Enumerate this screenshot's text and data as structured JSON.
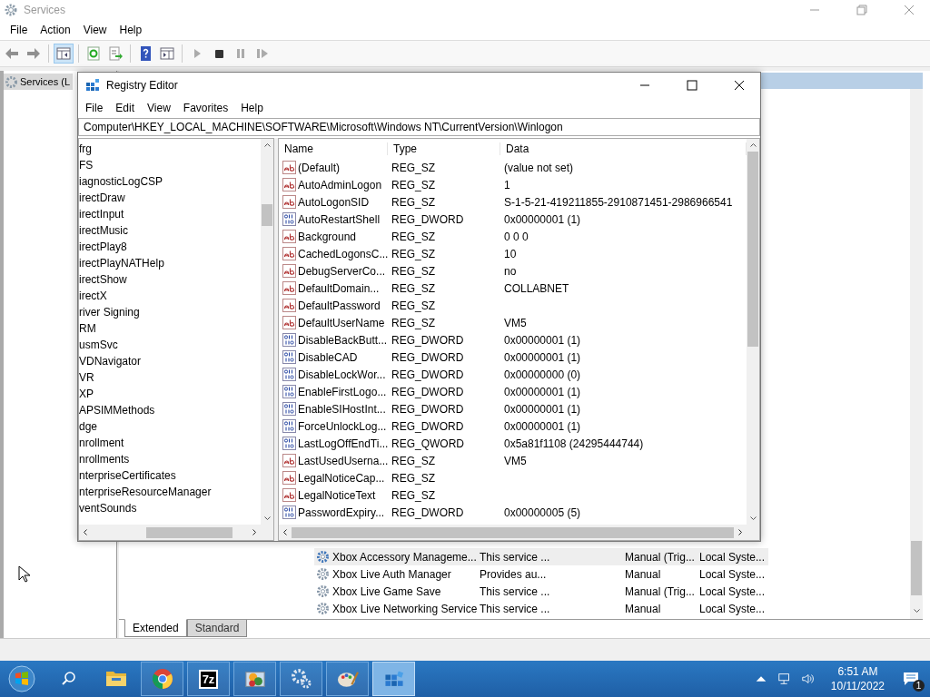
{
  "services_window": {
    "title": "Services",
    "menu": [
      "File",
      "Action",
      "View",
      "Help"
    ],
    "toolbar": [
      {
        "kind": "back",
        "pressed": false,
        "disabled": true
      },
      {
        "kind": "forward",
        "pressed": false,
        "disabled": true
      },
      {
        "kind": "console-tree",
        "pressed": true,
        "disabled": false
      },
      {
        "kind": "refresh",
        "pressed": false,
        "disabled": false
      },
      {
        "kind": "export",
        "pressed": false,
        "disabled": false
      },
      {
        "kind": "help",
        "pressed": false,
        "disabled": false
      },
      {
        "kind": "properties",
        "pressed": false,
        "disabled": false
      },
      {
        "kind": "play",
        "pressed": false,
        "disabled": true
      },
      {
        "kind": "stop",
        "pressed": false,
        "disabled": false
      },
      {
        "kind": "pause",
        "pressed": false,
        "disabled": true
      },
      {
        "kind": "resume",
        "pressed": false,
        "disabled": true
      }
    ],
    "tree": [
      {
        "label": "Services (L",
        "selected": true
      }
    ],
    "services": [
      {
        "name": "Xbox Accessory Manageme...",
        "description": "This service ...",
        "startup_type": "Manual (Trig...",
        "log_on_as": "Local Syste...",
        "selected": true
      },
      {
        "name": "Xbox Live Auth Manager",
        "description": "Provides au...",
        "startup_type": "Manual",
        "log_on_as": "Local Syste...",
        "selected": false
      },
      {
        "name": "Xbox Live Game Save",
        "description": "This service ...",
        "startup_type": "Manual (Trig...",
        "log_on_as": "Local Syste...",
        "selected": false
      },
      {
        "name": "Xbox Live Networking Service",
        "description": "This service ...",
        "startup_type": "Manual",
        "log_on_as": "Local Syste...",
        "selected": false
      }
    ],
    "view_tabs": [
      {
        "label": "Extended",
        "selected": true
      },
      {
        "label": "Standard",
        "selected": false
      }
    ]
  },
  "registry_editor": {
    "title": "Registry Editor",
    "menu": [
      "File",
      "Edit",
      "View",
      "Favorites",
      "Help"
    ],
    "address": "Computer\\HKEY_LOCAL_MACHINE\\SOFTWARE\\Microsoft\\Windows NT\\CurrentVersion\\Winlogon",
    "tree": [
      "frg",
      "FS",
      "iagnosticLogCSP",
      "irectDraw",
      "irectInput",
      "irectMusic",
      "irectPlay8",
      "irectPlayNATHelp",
      "irectShow",
      "irectX",
      "river Signing",
      "RM",
      "usmSvc",
      "VDNavigator",
      "VR",
      "XP",
      "APSIMMethods",
      "dge",
      "nrollment",
      "nrollments",
      "nterpriseCertificates",
      "nterpriseResourceManager",
      "ventSounds"
    ],
    "columns": [
      "Name",
      "Type",
      "Data"
    ],
    "values": [
      {
        "kind": "string",
        "name": "(Default)",
        "type": "REG_SZ",
        "data": "(value not set)"
      },
      {
        "kind": "string",
        "name": "AutoAdminLogon",
        "type": "REG_SZ",
        "data": "1"
      },
      {
        "kind": "string",
        "name": "AutoLogonSID",
        "type": "REG_SZ",
        "data": "S-1-5-21-419211855-2910871451-2986966541"
      },
      {
        "kind": "binary",
        "name": "AutoRestartShell",
        "type": "REG_DWORD",
        "data": "0x00000001 (1)"
      },
      {
        "kind": "string",
        "name": "Background",
        "type": "REG_SZ",
        "data": "0 0 0"
      },
      {
        "kind": "string",
        "name": "CachedLogonsC...",
        "type": "REG_SZ",
        "data": "10"
      },
      {
        "kind": "string",
        "name": "DebugServerCo...",
        "type": "REG_SZ",
        "data": "no"
      },
      {
        "kind": "string",
        "name": "DefaultDomain...",
        "type": "REG_SZ",
        "data": "COLLABNET"
      },
      {
        "kind": "string",
        "name": "DefaultPassword",
        "type": "REG_SZ"
      },
      {
        "kind": "string",
        "name": "DefaultUserName",
        "type": "REG_SZ",
        "data": "VM5"
      },
      {
        "kind": "binary",
        "name": "DisableBackButt...",
        "type": "REG_DWORD",
        "data": "0x00000001 (1)"
      },
      {
        "kind": "binary",
        "name": "DisableCAD",
        "type": "REG_DWORD",
        "data": "0x00000001 (1)"
      },
      {
        "kind": "binary",
        "name": "DisableLockWor...",
        "type": "REG_DWORD",
        "data": "0x00000000 (0)"
      },
      {
        "kind": "binary",
        "name": "EnableFirstLogo...",
        "type": "REG_DWORD",
        "data": "0x00000001 (1)"
      },
      {
        "kind": "binary",
        "name": "EnableSIHostInt...",
        "type": "REG_DWORD",
        "data": "0x00000001 (1)"
      },
      {
        "kind": "binary",
        "name": "ForceUnlockLog...",
        "type": "REG_DWORD",
        "data": "0x00000001 (1)"
      },
      {
        "kind": "binary",
        "name": "LastLogOffEndTi...",
        "type": "REG_QWORD",
        "data": "0x5a81f1108 (24295444744)"
      },
      {
        "kind": "string",
        "name": "LastUsedUserna...",
        "type": "REG_SZ",
        "data": "VM5"
      },
      {
        "kind": "string",
        "name": "LegalNoticeCap...",
        "type": "REG_SZ"
      },
      {
        "kind": "string",
        "name": "LegalNoticeText",
        "type": "REG_SZ"
      },
      {
        "kind": "binary",
        "name": "PasswordExpiry...",
        "type": "REG_DWORD",
        "data": "0x00000005 (5)"
      }
    ]
  },
  "taskbar": {
    "apps": [
      {
        "kind": "explorer",
        "running": false,
        "selected": false
      },
      {
        "kind": "chrome",
        "running": true,
        "selected": false
      },
      {
        "kind": "archiver",
        "label": "7z",
        "running": true,
        "selected": false
      },
      {
        "kind": "control-panel",
        "running": true,
        "selected": false
      },
      {
        "kind": "services",
        "running": true,
        "selected": false
      },
      {
        "kind": "paint",
        "running": true,
        "selected": false
      },
      {
        "kind": "registry",
        "running": true,
        "selected": true
      }
    ],
    "time": "6:51 AM",
    "date": "10/11/2022",
    "notification_count": "1"
  }
}
